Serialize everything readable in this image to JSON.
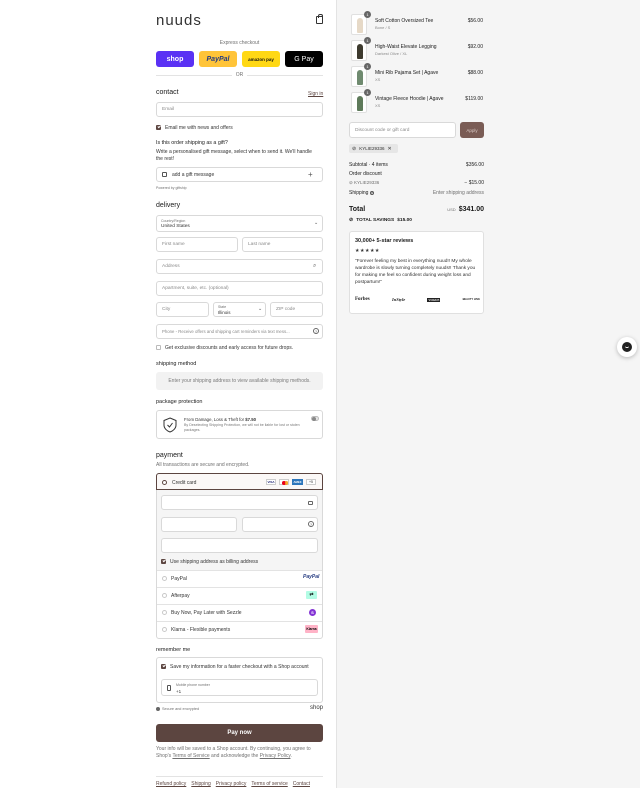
{
  "header": {
    "logo": "nuuds"
  },
  "express": {
    "title": "Express checkout",
    "buttons": [
      {
        "label": "shop",
        "bg": "#5a31f4",
        "color": "#ffffff"
      },
      {
        "label": "PayPal",
        "bg": "#ffc439",
        "color": "#253b80"
      },
      {
        "label": "amazon pay",
        "bg": "#ffd814",
        "color": "#111111"
      },
      {
        "label": "G Pay",
        "bg": "#000000",
        "color": "#ffffff"
      }
    ],
    "or": "OR"
  },
  "contact": {
    "title": "contact",
    "sign_in": "Sign in",
    "email_placeholder": "Email",
    "newsletter": "Email me with news and offers"
  },
  "gift": {
    "question": "Is this order shipping as a gift?",
    "desc": "Write a personalised gift message, select when to send it. We'll handle the rest!",
    "add_label": "add a gift message",
    "powered": "Powered by giftship"
  },
  "delivery": {
    "title": "delivery",
    "country_label": "Country/Region",
    "country_value": "United States",
    "first_name": "First name",
    "last_name": "Last name",
    "address": "Address",
    "apartment": "Apartment, suite, etc. (optional)",
    "city": "City",
    "state_label": "State",
    "state_value": "Illinois",
    "zip": "ZIP code",
    "phone": "Phone - Receive offers and shipping cart reminders via text mess...",
    "sms_optin": "Get exclusive discounts and early access for future drops."
  },
  "shipping_method": {
    "title": "shipping method",
    "placeholder": "Enter your shipping address to view available shipping methods."
  },
  "protection": {
    "title": "package protection",
    "line1_pre": "From Damage, Loss & Theft for ",
    "line1_price": "$7.50",
    "line2": "By Deselecting Shipping Protection, we will not be liable for lost or stolen packages."
  },
  "payment": {
    "title": "payment",
    "subtitle": "All transactions are secure and encrypted.",
    "credit_card": "Credit card",
    "card_brands": [
      "VISA",
      "MC",
      "AMEX",
      "+5"
    ],
    "use_shipping": "Use shipping address as billing address",
    "alternatives": [
      {
        "label": "PayPal",
        "badge": "PayPal",
        "badge_color": "#253b80",
        "badge_bg": "#ffffff"
      },
      {
        "label": "Afterpay",
        "badge": "⇄",
        "badge_color": "#000000",
        "badge_bg": "#b2fce4"
      },
      {
        "label": "Buy Now, Pay Later with Sezzle",
        "badge": "S",
        "badge_color": "#ffffff",
        "badge_bg": "#8333d4"
      },
      {
        "label": "Klarna - Flexible payments",
        "badge": "Klarna",
        "badge_color": "#000000",
        "badge_bg": "#ffb3c7"
      }
    ]
  },
  "remember": {
    "title": "remember me",
    "save_info": "Save my information for a faster checkout with a Shop account",
    "mobile_label": "Mobile phone number",
    "mobile_value": "+1",
    "secure": "Secure and encrypted",
    "shop_brand": "shop"
  },
  "actions": {
    "pay_now": "Pay now"
  },
  "legal": {
    "pre": "Your info will be saved to a Shop account. By continuing, you agree to Shop's ",
    "terms": "Terms of Service",
    "mid": " and acknowledge the ",
    "privacy": "Privacy Policy",
    "post": "."
  },
  "footer_links": [
    "Refund policy",
    "Shipping",
    "Privacy policy",
    "Terms of service",
    "Contact"
  ],
  "order": {
    "items": [
      {
        "name": "Soft Cotton Oversized Tee",
        "variant": "Bone / S",
        "price": "$56.00",
        "qty": "1",
        "color": "#e6d9c7"
      },
      {
        "name": "High-Waist Elevate Legging",
        "variant": "Darkest Olive / XL",
        "price": "$92.00",
        "qty": "1",
        "color": "#3d3a2e"
      },
      {
        "name": "Mini Rib Pajama Set | Agave",
        "variant": "XS",
        "price": "$88.00",
        "qty": "1",
        "color": "#6f8a6f"
      },
      {
        "name": "Vintage Fleece Hoodie | Agave",
        "variant": "XS",
        "price": "$119.00",
        "qty": "1",
        "color": "#5e7a5a"
      }
    ],
    "discount_placeholder": "Discount code or gift card",
    "apply": "Apply",
    "code_chip": "KYLIE29336",
    "subtotal_label": "Subtotal · 4 items",
    "subtotal_value": "$356.00",
    "discount_label": "Order discount",
    "discount_code": "KYLIE29336",
    "discount_value": "− $15.00",
    "shipping_label": "Shipping",
    "shipping_value": "Enter shipping address",
    "total_label": "Total",
    "currency": "USD",
    "total_value": "$341.00",
    "savings_label": "TOTAL SAVINGS",
    "savings_value": "$15.00"
  },
  "reviews": {
    "title": "30,000+ 5-star reviews",
    "stars": "★★★★★",
    "quote": "\"Forever feeling my best in everything nuud!! My whole wardrobe is slowly turning completely nuuds!! Thank you for making me feel so confident during weight loss and postpartum!\"",
    "press": [
      "Forbes",
      "InStyle",
      "VOGUE",
      "BEAUTY HIVE"
    ]
  },
  "colors": {
    "accent": "#5c4540",
    "apply_bg": "#7a5c55",
    "border": "#d9d9d9"
  }
}
